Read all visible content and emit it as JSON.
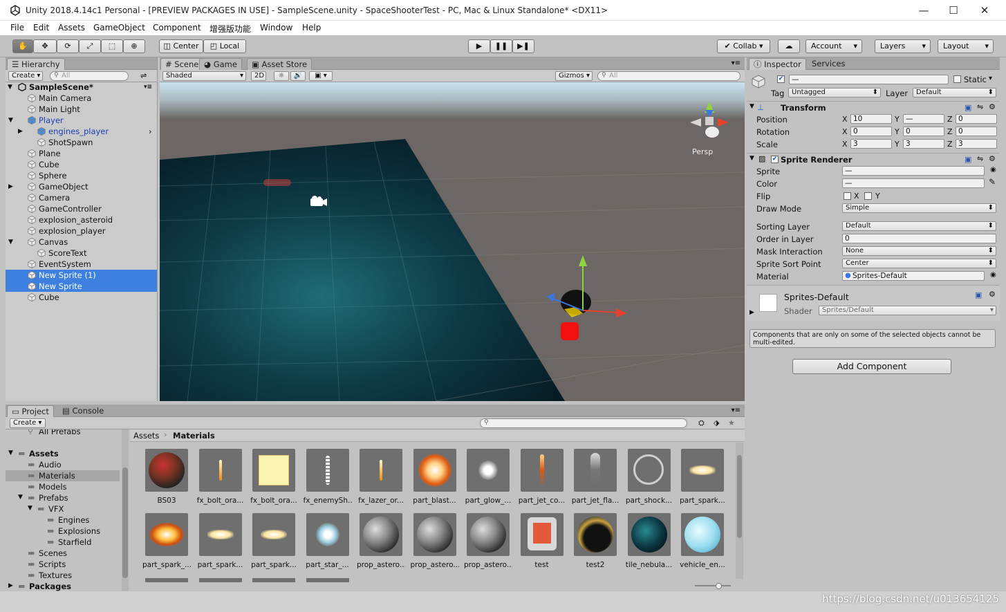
{
  "window": {
    "title": "Unity 2018.4.14c1 Personal - [PREVIEW PACKAGES IN USE] - SampleScene.unity - SpaceShooterTest - PC, Mac & Linux Standalone* <DX11>",
    "min": "—",
    "max": "☐",
    "close": "✕"
  },
  "menu": [
    "File",
    "Edit",
    "Assets",
    "GameObject",
    "Component",
    "增强版功能",
    "Window",
    "Help"
  ],
  "toolbar": {
    "center": "Center",
    "local": "Local",
    "collab": "Collab ▾",
    "account": "Account",
    "layers": "Layers",
    "layout": "Layout"
  },
  "hierarchy": {
    "tab": "Hierarchy",
    "create": "Create ▾",
    "search_placeholder": "All",
    "scene": "SampleScene*",
    "items": [
      {
        "label": "Main Camera"
      },
      {
        "label": "Main Light"
      },
      {
        "label": "Player"
      },
      {
        "label": "engines_player"
      },
      {
        "label": "ShotSpawn"
      },
      {
        "label": "Plane"
      },
      {
        "label": "Cube"
      },
      {
        "label": "Sphere"
      },
      {
        "label": "GameObject"
      },
      {
        "label": "Camera"
      },
      {
        "label": "GameController"
      },
      {
        "label": "explosion_asteroid"
      },
      {
        "label": "explosion_player"
      },
      {
        "label": "Canvas"
      },
      {
        "label": "ScoreText"
      },
      {
        "label": "EventSystem"
      },
      {
        "label": "New Sprite (1)"
      },
      {
        "label": "New Sprite"
      },
      {
        "label": "Cube"
      }
    ]
  },
  "scene": {
    "tabs": [
      "Scene",
      "Game",
      "Asset Store"
    ],
    "shading": "Shaded",
    "mode2d": "2D",
    "gizmos": "Gizmos",
    "search_placeholder": "All",
    "persp": "Persp",
    "axis_colors": {
      "x": "#e8412b",
      "y": "#8fd23c",
      "z": "#3a77e0"
    }
  },
  "inspector": {
    "tabs": [
      "Inspector",
      "Services"
    ],
    "name_value": "—",
    "static": "Static",
    "tag_label": "Tag",
    "tag": "Untagged",
    "layer_label": "Layer",
    "layer": "Default",
    "transform": {
      "title": "Transform",
      "position_label": "Position",
      "rotation_label": "Rotation",
      "scale_label": "Scale",
      "axis_x": "X",
      "axis_y": "Y",
      "axis_z": "Z",
      "position": [
        "10",
        "—",
        "0"
      ],
      "rotation": [
        "0",
        "0",
        "0"
      ],
      "scale": [
        "3",
        "3",
        "3"
      ]
    },
    "sprite_renderer": {
      "title": "Sprite Renderer",
      "sprite_label": "Sprite",
      "sprite": "—",
      "color_label": "Color",
      "color": "—",
      "flip_label": "Flip",
      "flip_x": "X",
      "flip_y": "Y",
      "draw_mode_label": "Draw Mode",
      "draw_mode": "Simple",
      "sorting_layer_label": "Sorting Layer",
      "sorting_layer": "Default",
      "order_label": "Order in Layer",
      "order": "0",
      "mask_label": "Mask Interaction",
      "mask": "None",
      "sort_point_label": "Sprite Sort Point",
      "sort_point": "Center",
      "material_label": "Material",
      "material": "Sprites-Default"
    },
    "material": {
      "name": "Sprites-Default",
      "shader_label": "Shader",
      "shader": "Sprites/Default"
    },
    "note": "Components that are only on some of the selected objects cannot be multi-edited.",
    "add_component": "Add Component"
  },
  "project": {
    "tabs": [
      "Project",
      "Console"
    ],
    "create": "Create ▾",
    "breadcrumb": [
      "Assets",
      "Materials"
    ],
    "tree": [
      {
        "label": "All Prefabs",
        "indent": 2
      },
      {
        "label": "Assets",
        "indent": 1,
        "bold": true
      },
      {
        "label": "Audio",
        "indent": 2
      },
      {
        "label": "Materials",
        "indent": 2,
        "sel": true
      },
      {
        "label": "Models",
        "indent": 2
      },
      {
        "label": "Prefabs",
        "indent": 2
      },
      {
        "label": "VFX",
        "indent": 3
      },
      {
        "label": "Engines",
        "indent": 4
      },
      {
        "label": "Explosions",
        "indent": 4
      },
      {
        "label": "Starfield",
        "indent": 4
      },
      {
        "label": "Scenes",
        "indent": 2
      },
      {
        "label": "Scripts",
        "indent": 2
      },
      {
        "label": "Textures",
        "indent": 2
      },
      {
        "label": "Packages",
        "indent": 1,
        "bold": true
      }
    ],
    "assets_row1": [
      "BS03",
      "fx_bolt_ora...",
      "fx_bolt_ora...",
      "fx_enemySh...",
      "fx_lazer_or...",
      "part_blast...",
      "part_glow_...",
      "part_jet_co...",
      "part_jet_fla...",
      "part_shock...",
      "part_spark..."
    ],
    "assets_row2": [
      "part_spark_...",
      "part_spark...",
      "part_spark...",
      "part_star_...",
      "prop_astero...",
      "prop_astero...",
      "prop_astero...",
      "test",
      "test2",
      "tile_nebula...",
      "vehicle_en..."
    ]
  },
  "watermark": "https://blog.csdn.net/u013654125"
}
